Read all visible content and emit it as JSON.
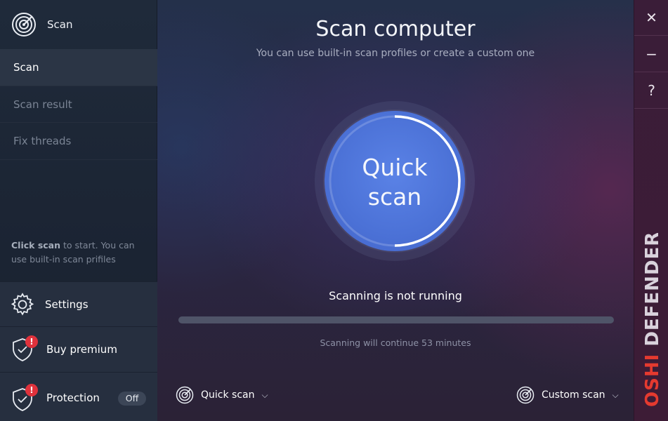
{
  "sidebar": {
    "header_title": "Scan",
    "items": [
      {
        "label": "Scan"
      },
      {
        "label": "Scan result"
      },
      {
        "label": "Fix threads"
      }
    ],
    "hint_bold": "Click scan",
    "hint_rest": " to start. You can use built-in scan prifiles",
    "settings_label": "Settings",
    "premium_label": "Buy premium",
    "premium_badge": "!",
    "protection_label": "Protection",
    "protection_badge": "!",
    "protection_toggle": "Off"
  },
  "main": {
    "title": "Scan computer",
    "subtitle": "You can use built-in scan profiles or create a custom one",
    "scan_button_line1": "Quick",
    "scan_button_line2": "scan",
    "status": "Scanning is not running",
    "progress_percent": 0,
    "eta": "Scanning will continue 53 minutes",
    "quick_dropdown": "Quick scan",
    "custom_dropdown": "Custom scan"
  },
  "window": {
    "close": "✕",
    "minimize": "−",
    "help": "?"
  },
  "brand": {
    "name": "OSHI DEFENDER",
    "accent": "#e53a2f"
  }
}
